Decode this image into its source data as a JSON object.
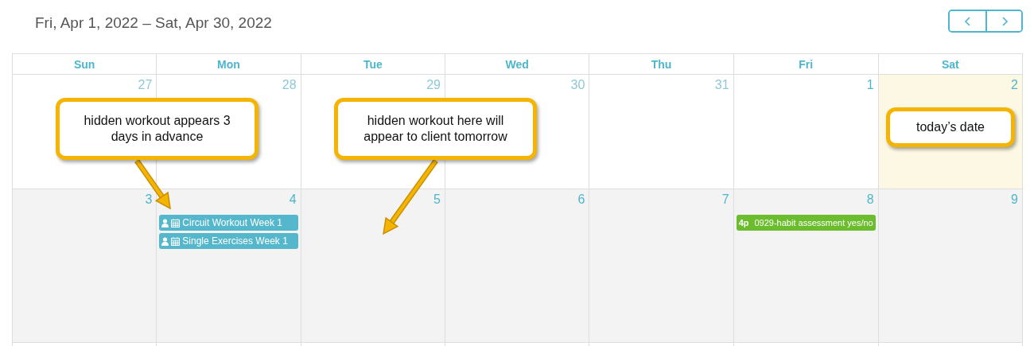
{
  "title": "Fri, Apr 1, 2022 – Sat, Apr 30, 2022",
  "nav": [
    {
      "kind": "prev"
    },
    {
      "kind": "next"
    }
  ],
  "weekdays": [
    "Sun",
    "Mon",
    "Tue",
    "Wed",
    "Thu",
    "Fri",
    "Sat"
  ],
  "weeks": [
    {
      "shaded": false,
      "days": [
        {
          "number": "27",
          "in_month": false,
          "today": false
        },
        {
          "number": "28",
          "in_month": false,
          "today": false
        },
        {
          "number": "29",
          "in_month": false,
          "today": false
        },
        {
          "number": "30",
          "in_month": false,
          "today": false
        },
        {
          "number": "31",
          "in_month": false,
          "today": false
        },
        {
          "number": "1",
          "in_month": true,
          "today": false
        },
        {
          "number": "2",
          "in_month": true,
          "today": true
        }
      ]
    },
    {
      "shaded": true,
      "days": [
        {
          "number": "3",
          "in_month": true,
          "today": false
        },
        {
          "number": "4",
          "in_month": true,
          "today": false,
          "events": [
            {
              "kind": "workout",
              "title": "Circuit Workout Week 1",
              "color": "#55b7cc"
            },
            {
              "kind": "workout",
              "title": "Single Exercises Week 1",
              "color": "#55b7cc"
            }
          ]
        },
        {
          "number": "5",
          "in_month": true,
          "today": false
        },
        {
          "number": "6",
          "in_month": true,
          "today": false
        },
        {
          "number": "7",
          "in_month": true,
          "today": false
        },
        {
          "number": "8",
          "in_month": true,
          "today": false,
          "events": [
            {
              "kind": "appointment",
              "time": "4p",
              "title": "0929-habit assessment yes/no",
              "color": "#6cbd2e"
            }
          ]
        },
        {
          "number": "9",
          "in_month": true,
          "today": false
        }
      ]
    }
  ],
  "callouts": [
    {
      "text": "hidden workout appears 3 days in advance",
      "arrow": true
    },
    {
      "text": "hidden workout here will appear to client tomorrow",
      "arrow": true
    },
    {
      "text": "today’s date"
    }
  ]
}
